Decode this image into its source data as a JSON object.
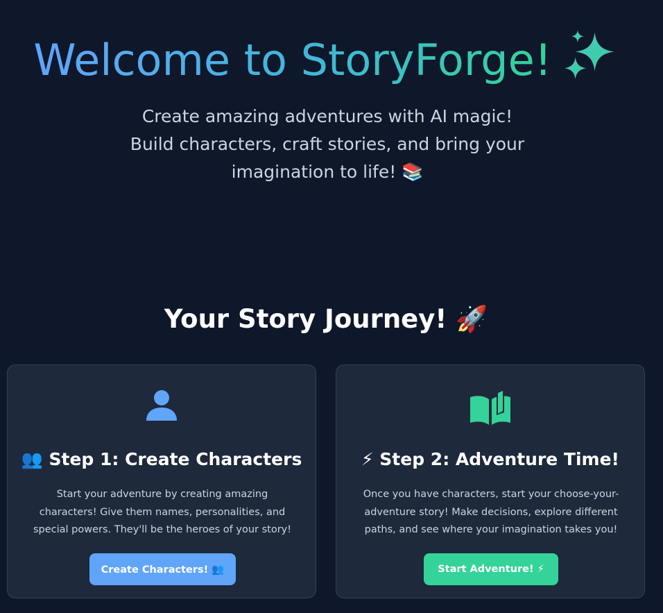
{
  "hero": {
    "title": "Welcome to StoryForge!",
    "title_icon": "sparkles-icon",
    "subtitle": "Create amazing adventures with AI magic! Build characters, craft stories, and bring your imagination to life! 📚"
  },
  "journey": {
    "heading": "Your Story Journey! 🚀",
    "cards": [
      {
        "icon": "user-icon",
        "title": "👥 Step 1: Create Characters",
        "description": "Start your adventure by creating amazing characters! Give them names, personalities, and special powers. They'll be the heroes of your story!",
        "button_label": "Create Characters! 👥",
        "accent": "#60a5fa"
      },
      {
        "icon": "book-open-icon",
        "title": "⚡ Step 2: Adventure Time!",
        "description": "Once you have characters, start your choose-your-adventure story! Make decisions, explore different paths, and see where your imagination takes you!",
        "button_label": "Start Adventure! ⚡",
        "accent": "#34d399"
      }
    ]
  },
  "colors": {
    "background": "#0f172a",
    "card_background": "#1e293b",
    "gradient_start": "#60a5fa",
    "gradient_end": "#34d399"
  }
}
